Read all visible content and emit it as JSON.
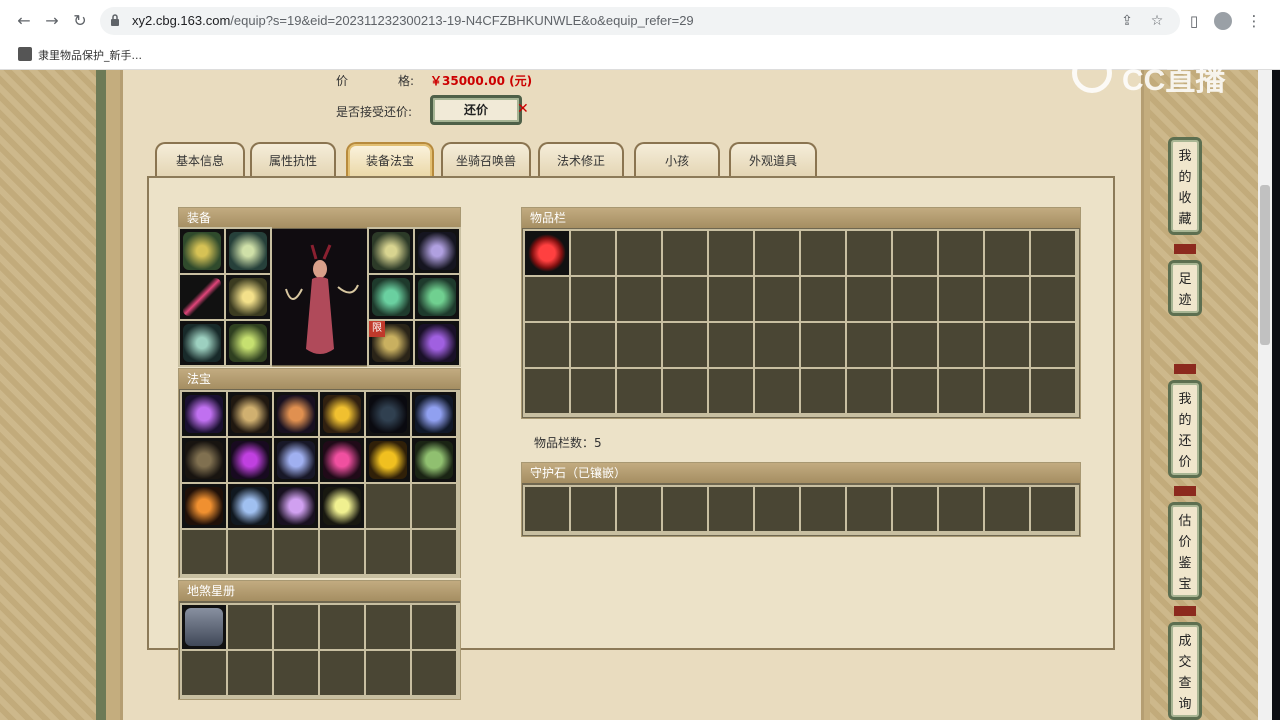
{
  "browser": {
    "url_host": "xy2.cbg.163.com",
    "url_rest": "/equip?s=19&eid=202311232300213-19-N4CFZBHKUNWLE&o&equip_refer=29",
    "bookmark_label": "隶里物品保护_新手..."
  },
  "watermark": "CC直播",
  "price": {
    "label_part1": "价",
    "label_part2": "格:",
    "value": "￥35000.00 (元)",
    "counter_label": "是否接受还价:",
    "counter_button": "还价"
  },
  "tabs": [
    {
      "label": "基本信息",
      "active": false
    },
    {
      "label": "属性抗性",
      "active": false
    },
    {
      "label": "装备法宝",
      "active": true
    },
    {
      "label": "坐骑召唤兽",
      "active": false
    },
    {
      "label": "法术修正",
      "active": false
    },
    {
      "label": "小孩",
      "active": false
    },
    {
      "label": "外观道具",
      "active": false
    }
  ],
  "sections": {
    "equipment": "装备",
    "treasure": "法宝",
    "star_book": "地煞星册",
    "inventory": "物品栏",
    "guard_stone": "守护石（已镶嵌）"
  },
  "inventory_count": "物品栏数：5",
  "equipment_badge": "限",
  "sidebar": [
    {
      "label": [
        "我",
        "的",
        "收",
        "藏"
      ]
    },
    {
      "label": [
        "足",
        "迹"
      ]
    },
    {
      "label": [
        "我",
        "的",
        "还",
        "价"
      ]
    },
    {
      "label": [
        "估",
        "价",
        "鉴",
        "宝"
      ]
    },
    {
      "label": [
        "成",
        "交",
        "查",
        "询"
      ]
    }
  ],
  "colors": {
    "accent_red": "#cc0000",
    "tab_active_border": "#b78a3c",
    "panel_bg": "#ece2c8",
    "slot_bg": "#4a4634"
  }
}
